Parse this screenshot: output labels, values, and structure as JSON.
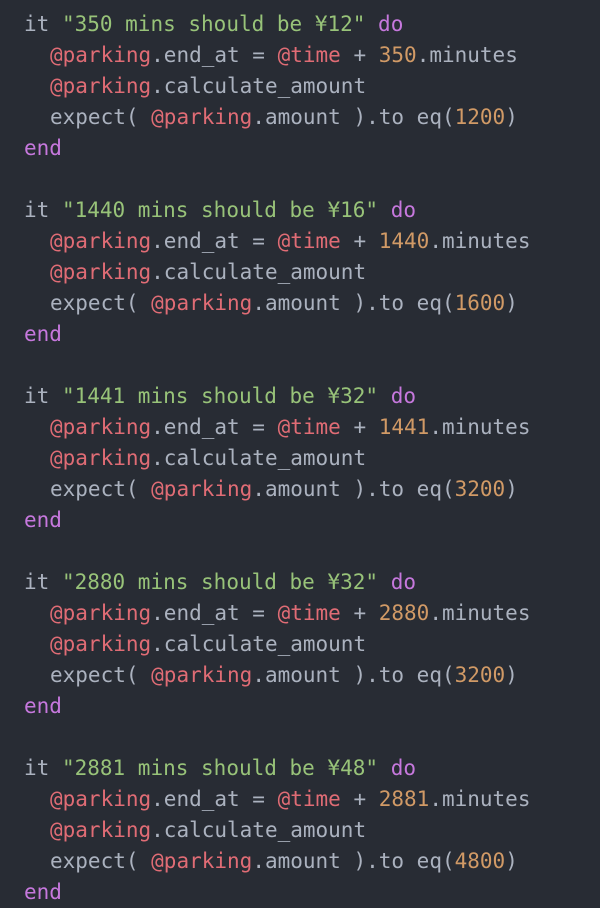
{
  "theme": {
    "background": "#282c34",
    "plain": "#abb2bf",
    "string": "#98c379",
    "keyword": "#c678dd",
    "instance_variable": "#e06c75",
    "number": "#d19a66"
  },
  "tokens": {
    "it": "it",
    "do": "do",
    "end": "end",
    "parking": "@parking",
    "time": "@time",
    "end_at_assign": ".end_at = ",
    "plus": " + ",
    "minutes": ".minutes",
    "calculate": ".calculate_amount",
    "expect_open": "expect( ",
    "amount_to": ".amount ).to eq(",
    "close_paren": ")"
  },
  "tests": [
    {
      "description": "\"350 mins should be ¥12\"",
      "minutes": "350",
      "expected": "1200"
    },
    {
      "description": "\"1440 mins should be ¥16\"",
      "minutes": "1440",
      "expected": "1600"
    },
    {
      "description": "\"1441 mins should be ¥32\"",
      "minutes": "1441",
      "expected": "3200"
    },
    {
      "description": "\"2880 mins should be ¥32\"",
      "minutes": "2880",
      "expected": "3200"
    },
    {
      "description": "\"2881 mins should be ¥48\"",
      "minutes": "2881",
      "expected": "4800"
    }
  ]
}
